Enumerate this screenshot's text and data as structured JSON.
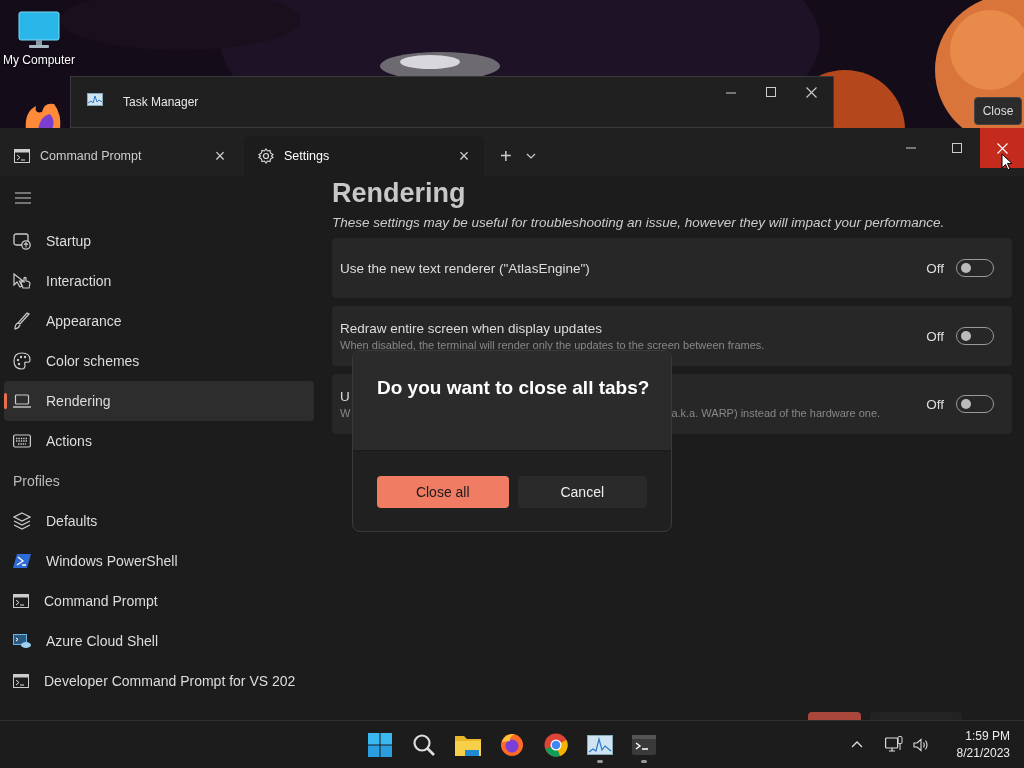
{
  "desktop": {
    "icons": [
      {
        "kind": "computer",
        "label": "My Computer"
      },
      {
        "kind": "firefox"
      }
    ]
  },
  "task_manager_window": {
    "title": "Task Manager"
  },
  "tooltip": {
    "text": "Close"
  },
  "terminal": {
    "tabs": [
      {
        "kind": "cmd",
        "label": "Command Prompt",
        "selected": false,
        "close": "×"
      },
      {
        "kind": "settings",
        "label": "Settings",
        "selected": true,
        "close": "×"
      }
    ],
    "new_tab": "+",
    "sidebar": {
      "items": [
        {
          "kind": "startup",
          "label": "Startup",
          "selected": false
        },
        {
          "kind": "interaction",
          "label": "Interaction",
          "selected": false
        },
        {
          "kind": "appearance",
          "label": "Appearance",
          "selected": false
        },
        {
          "kind": "colors",
          "label": "Color schemes",
          "selected": false
        },
        {
          "kind": "rendering",
          "label": "Rendering",
          "selected": true
        },
        {
          "kind": "actions",
          "label": "Actions",
          "selected": false
        }
      ],
      "section": "Profiles",
      "profiles": [
        {
          "kind": "defaults",
          "label": "Defaults",
          "selected": false
        },
        {
          "kind": "powershell",
          "label": "Windows PowerShell",
          "selected": false
        },
        {
          "kind": "cmd",
          "label": "Command Prompt",
          "selected": false
        },
        {
          "kind": "azure",
          "label": "Azure Cloud Shell",
          "selected": false
        },
        {
          "kind": "cmd",
          "label": "Developer Command Prompt for VS 202",
          "selected": false
        }
      ]
    },
    "page_title": "Rendering",
    "page_subtitle": "These settings may be useful for troubleshooting an issue, however they will impact your performance.",
    "settings": [
      {
        "title": "Use the new text renderer (\"AtlasEngine\")",
        "state_label": "Off",
        "on": false
      },
      {
        "title": "Redraw entire screen when display updates",
        "description": "When disabled, the terminal will render only the updates to the screen between frames.",
        "state_label": "Off",
        "on": false
      },
      {
        "title": "U",
        "description": "W",
        "description_tail": "a.k.a. WARP) instead of the hardware one.",
        "state_label": "Off",
        "on": false
      }
    ],
    "footer_buttons": [
      {
        "kind": "primary"
      },
      {
        "kind": "secondary"
      }
    ]
  },
  "dialog": {
    "title": "Do you want to close all tabs?",
    "buttons": [
      {
        "label": "Close all",
        "kind": "primary"
      },
      {
        "label": "Cancel",
        "kind": "secondary"
      }
    ]
  },
  "taskbar": {
    "apps": [
      {
        "kind": "start",
        "running": false
      },
      {
        "kind": "search",
        "running": false
      },
      {
        "kind": "folder",
        "running": false
      },
      {
        "kind": "firefox",
        "running": false
      },
      {
        "kind": "chrome",
        "running": false
      },
      {
        "kind": "taskmgr",
        "running": true
      },
      {
        "kind": "terminal",
        "running": true
      }
    ],
    "time": "1:59 PM",
    "date": "8/21/2023"
  }
}
